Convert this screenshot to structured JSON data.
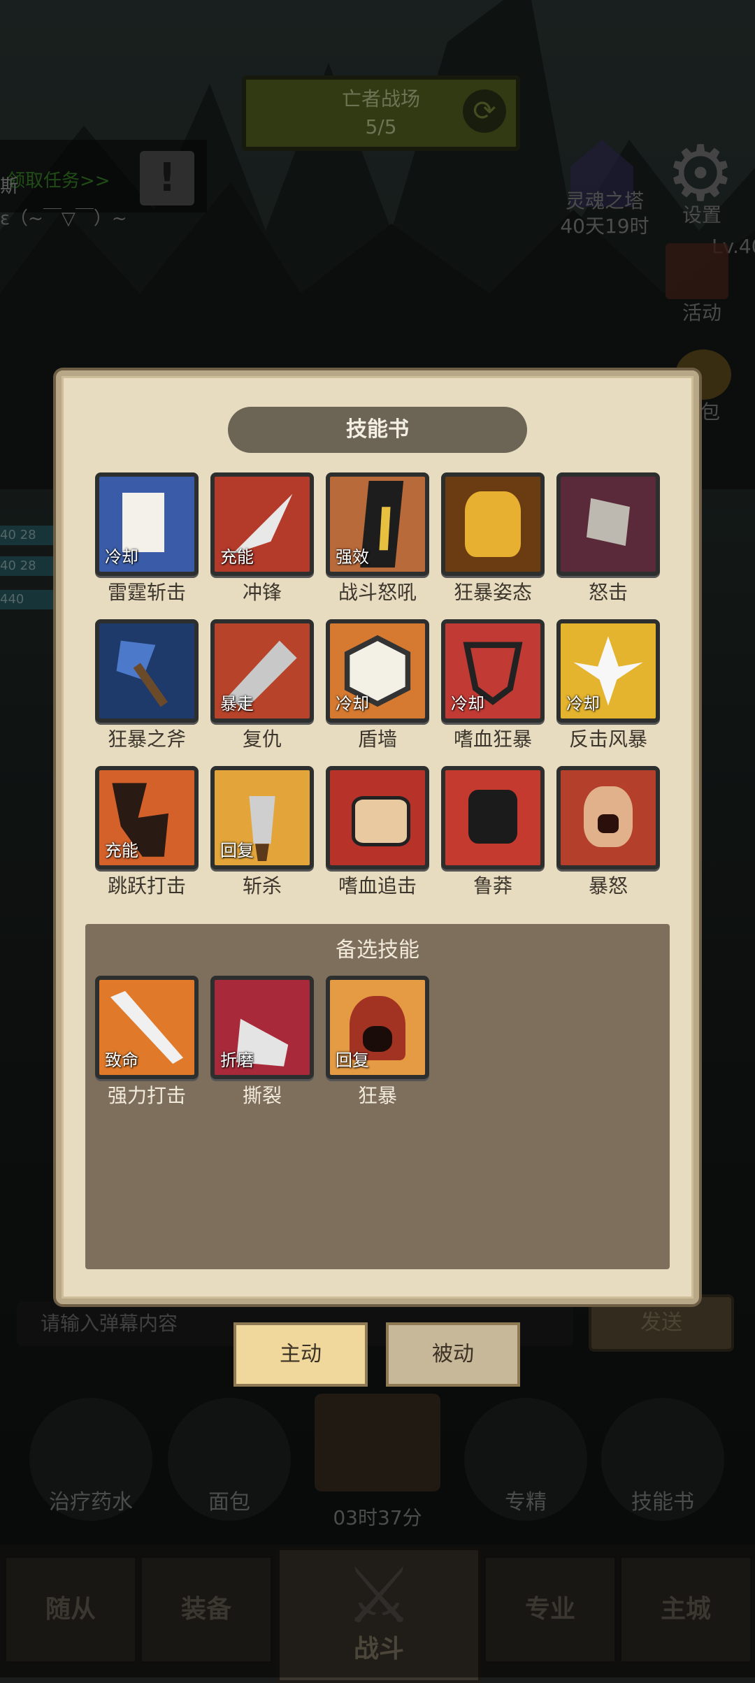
{
  "header": {
    "battle_title": "亡者战场",
    "battle_progress": "5/5"
  },
  "quest": {
    "link": "领取任务>>",
    "alert": "!",
    "player_name": "斯",
    "player_msg": "ε（~￣▽￣）~"
  },
  "side_menu": {
    "tower_label": "灵魂之塔",
    "tower_time": "40天19时",
    "settings_label": "设置",
    "level": "Lv.40",
    "activity_label": "活动",
    "bag_label": "包"
  },
  "stats": [
    "40  28",
    "40  28",
    "440"
  ],
  "skill_book": {
    "title": "技能书",
    "skills": [
      {
        "name": "雷霆斩击",
        "tag": "冷却"
      },
      {
        "name": "冲锋",
        "tag": "充能"
      },
      {
        "name": "战斗怒吼",
        "tag": "强效"
      },
      {
        "name": "狂暴姿态",
        "tag": ""
      },
      {
        "name": "怒击",
        "tag": ""
      },
      {
        "name": "狂暴之斧",
        "tag": ""
      },
      {
        "name": "复仇",
        "tag": "暴走"
      },
      {
        "name": "盾墙",
        "tag": "冷却"
      },
      {
        "name": "嗜血狂暴",
        "tag": "冷却"
      },
      {
        "name": "反击风暴",
        "tag": "冷却"
      },
      {
        "name": "跳跃打击",
        "tag": "充能"
      },
      {
        "name": "斩杀",
        "tag": "回复"
      },
      {
        "name": "嗜血追击",
        "tag": ""
      },
      {
        "name": "鲁莽",
        "tag": ""
      },
      {
        "name": "暴怒",
        "tag": ""
      }
    ],
    "alternate_title": "备选技能",
    "alternates": [
      {
        "name": "强力打击",
        "tag": "致命"
      },
      {
        "name": "撕裂",
        "tag": "折磨"
      },
      {
        "name": "狂暴",
        "tag": "回复"
      }
    ],
    "tab_active": "主动",
    "tab_passive": "被动"
  },
  "chat": {
    "placeholder": "请输入弹幕内容",
    "send_label": "发送"
  },
  "quick_items": {
    "potion": "治疗药水",
    "bread": "面包",
    "timer": "03时37分",
    "mastery": "专精",
    "skill_book": "技能书"
  },
  "nav": {
    "followers": "随从",
    "equipment": "装备",
    "battle": "战斗",
    "profession": "专业",
    "main_city": "主城"
  }
}
